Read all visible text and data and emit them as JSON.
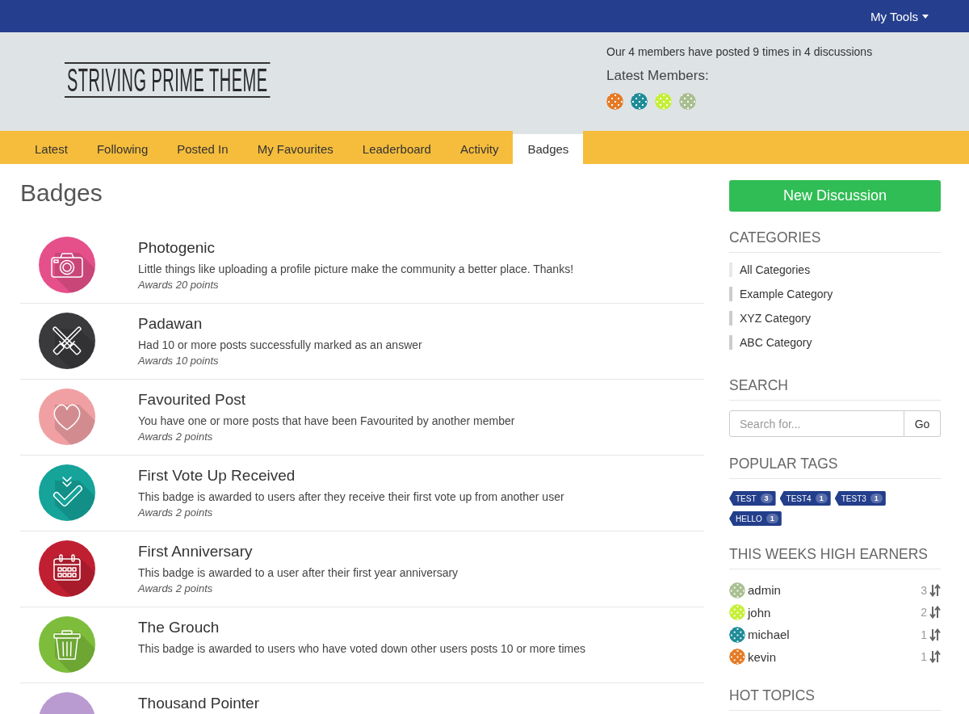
{
  "top_bar": {
    "menu_label": "My Tools"
  },
  "header": {
    "logo": "STRIVING PRIME THEME",
    "stats": "Our 4 members have posted 9 times in 4 discussions",
    "latest_members_label": "Latest Members:",
    "latest_members": [
      {
        "color": "#e57b26"
      },
      {
        "color": "#1f8c99"
      },
      {
        "color": "#c6ef3a"
      },
      {
        "color": "#a9bf92"
      }
    ]
  },
  "nav": {
    "tabs": [
      {
        "label": "Latest",
        "selected": false
      },
      {
        "label": "Following",
        "selected": false
      },
      {
        "label": "Posted In",
        "selected": false
      },
      {
        "label": "My Favourites",
        "selected": false
      },
      {
        "label": "Leaderboard",
        "selected": false
      },
      {
        "label": "Activity",
        "selected": false
      },
      {
        "label": "Badges",
        "selected": true
      }
    ]
  },
  "page_title": "Badges",
  "badges": [
    {
      "title": "Photogenic",
      "description": "Little things like uploading a profile picture make the community a better place. Thanks!",
      "awards": "Awards 20 points",
      "color": "#e5508a"
    },
    {
      "title": "Padawan",
      "description": "Had 10 or more posts successfully marked as an answer",
      "awards": "Awards 10 points",
      "color": "#3a3a3c"
    },
    {
      "title": "Favourited Post",
      "description": "You have one or more posts that have been Favourited by another member",
      "awards": "Awards 2 points",
      "color": "#f0a0a3"
    },
    {
      "title": "First Vote Up Received",
      "description": "This badge is awarded to users after they receive their first vote up from another user",
      "awards": "Awards 2 points",
      "color": "#15a39a"
    },
    {
      "title": "First Anniversary",
      "description": "This badge is awarded to a user after their first year anniversary",
      "awards": "Awards 2 points",
      "color": "#c01f32"
    },
    {
      "title": "The Grouch",
      "description": "This badge is awarded to users who have voted down other users posts 10 or more times",
      "color": "#7dbd3b"
    },
    {
      "title": "Thousand Pointer",
      "color": "#b99bd1"
    }
  ],
  "sidebar": {
    "new_discussion": "New Discussion",
    "categories": {
      "heading": "CATEGORIES",
      "items": [
        {
          "label": "All Categories",
          "color": "#e8e8e8"
        },
        {
          "label": "Example Category",
          "color": "#cccccc"
        },
        {
          "label": "XYZ Category",
          "color": "#cccccc"
        },
        {
          "label": "ABC Category",
          "color": "#cccccc"
        }
      ]
    },
    "search": {
      "heading": "SEARCH",
      "placeholder": "Search for...",
      "button": "Go"
    },
    "popular_tags": {
      "heading": "POPULAR TAGS",
      "tags": [
        {
          "label": "TEST",
          "count": "3"
        },
        {
          "label": "TEST4",
          "count": "1"
        },
        {
          "label": "TEST3",
          "count": "1"
        },
        {
          "label": "HELLO",
          "count": "1"
        }
      ]
    },
    "high_earners": {
      "heading": "THIS WEEKS HIGH EARNERS",
      "rows": [
        {
          "name": "admin",
          "points": "3",
          "color": "#a9bf92"
        },
        {
          "name": "john",
          "points": "2",
          "color": "#c6ef3a"
        },
        {
          "name": "michael",
          "points": "1",
          "color": "#1f8c99"
        },
        {
          "name": "kevin",
          "points": "1",
          "color": "#e57b26"
        }
      ]
    },
    "hot_topics": {
      "heading": "HOT TOPICS"
    }
  }
}
